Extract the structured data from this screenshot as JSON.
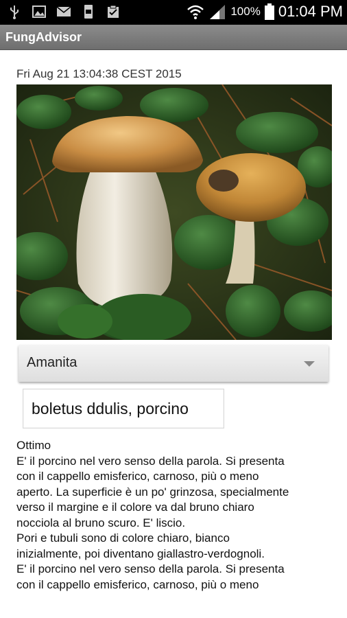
{
  "status_bar": {
    "battery_pct": "100%",
    "time": "01:04 PM",
    "icons": [
      "usb-icon",
      "image-icon",
      "mail-icon",
      "storage-icon",
      "clipboard-icon",
      "wifi-icon",
      "signal-icon",
      "battery-icon"
    ]
  },
  "app": {
    "title": "FungAdvisor"
  },
  "date_line": "Fri Aug 21 13:04:38 CEST 2015",
  "spinner": {
    "selected": "Amanita"
  },
  "name_field": {
    "value": "boletus ddulis, porcino"
  },
  "description": {
    "lines": [
      "Ottimo",
      "E' il porcino nel vero senso della parola. Si presenta",
      "con il cappello emisferico, carnoso, più o meno",
      "aperto. La superficie è un po' grinzosa, specialmente",
      "verso il margine e il colore va dal bruno chiaro",
      "nocciola al bruno scuro. E' liscio.",
      "Pori e tubuli sono di colore chiaro, bianco",
      "inizialmente, poi diventano giallastro-verdognoli.",
      "E' il porcino nel vero senso della parola. Si presenta",
      "con il cappello emisferico, carnoso, più o meno"
    ]
  }
}
